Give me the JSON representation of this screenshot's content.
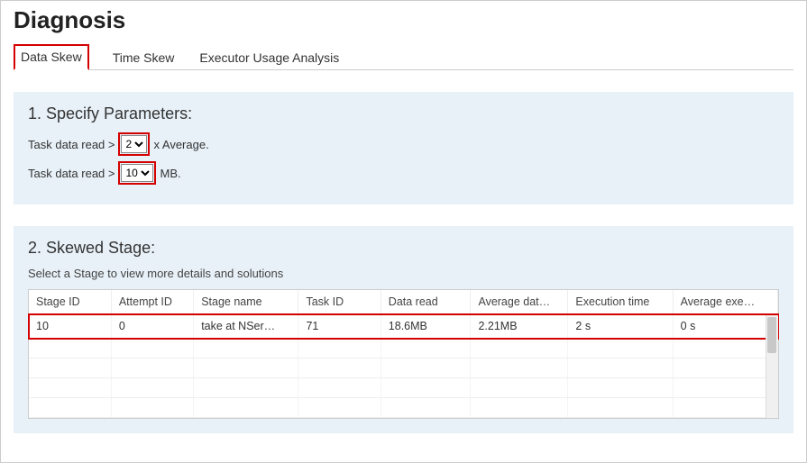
{
  "title": "Diagnosis",
  "tabs": {
    "data_skew": "Data Skew",
    "time_skew": "Time Skew",
    "executor_usage": "Executor Usage Analysis"
  },
  "section1": {
    "heading": "1. Specify Parameters:",
    "row1_prefix": "Task data read >",
    "row1_select_value": "2",
    "row1_suffix": "x Average.",
    "row2_prefix": "Task data read >",
    "row2_select_value": "10",
    "row2_suffix": "MB."
  },
  "section2": {
    "heading": "2. Skewed Stage:",
    "subtext": "Select a Stage to view more details and solutions",
    "columns": {
      "stage_id": "Stage ID",
      "attempt_id": "Attempt ID",
      "stage_name": "Stage name",
      "task_id": "Task ID",
      "data_read": "Data read",
      "avg_data": "Average dat…",
      "exec_time": "Execution time",
      "avg_exec": "Average exe…"
    },
    "row": {
      "stage_id": "10",
      "attempt_id": "0",
      "stage_name": "take at NSer…",
      "task_id": "71",
      "data_read": "18.6MB",
      "avg_data": "2.21MB",
      "exec_time": "2 s",
      "avg_exec": "0 s"
    }
  }
}
